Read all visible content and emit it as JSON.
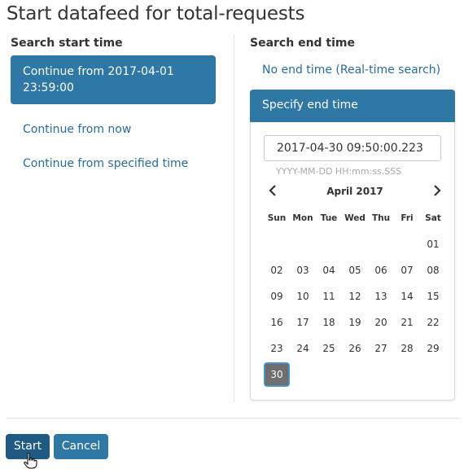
{
  "title": "Start datafeed for total-requests",
  "start": {
    "heading": "Search start time",
    "options": [
      "Continue from 2017-04-01 23:59:00",
      "Continue from now",
      "Continue from specified time"
    ]
  },
  "end": {
    "heading": "Search end time",
    "no_end": "No end time (Real-time search)",
    "specify": "Specify end time",
    "input_value": "2017-04-30 09:50:00.223",
    "format_hint": "YYYY-MM-DD HH:mm:ss.SSS",
    "calendar": {
      "prev_icon": "chevron-left-icon",
      "next_icon": "chevron-right-icon",
      "month": "April 2017",
      "weekdays": [
        "Sun",
        "Mon",
        "Tue",
        "Wed",
        "Thu",
        "Fri",
        "Sat"
      ],
      "weeks": [
        [
          "",
          "",
          "",
          "",
          "",
          "",
          "01"
        ],
        [
          "02",
          "03",
          "04",
          "05",
          "06",
          "07",
          "08"
        ],
        [
          "09",
          "10",
          "11",
          "12",
          "13",
          "14",
          "15"
        ],
        [
          "16",
          "17",
          "18",
          "19",
          "20",
          "21",
          "22"
        ],
        [
          "23",
          "24",
          "25",
          "26",
          "27",
          "28",
          "29"
        ],
        [
          "30",
          "",
          "",
          "",
          "",
          "",
          ""
        ]
      ],
      "selected": "30"
    }
  },
  "buttons": {
    "start": "Start",
    "cancel": "Cancel"
  },
  "colors": {
    "primary": "#2f78a6",
    "start_button": "#1f5a82",
    "selected_day": "#6e6e6e"
  },
  "icons": {
    "cursor": "hand-pointer-icon"
  }
}
